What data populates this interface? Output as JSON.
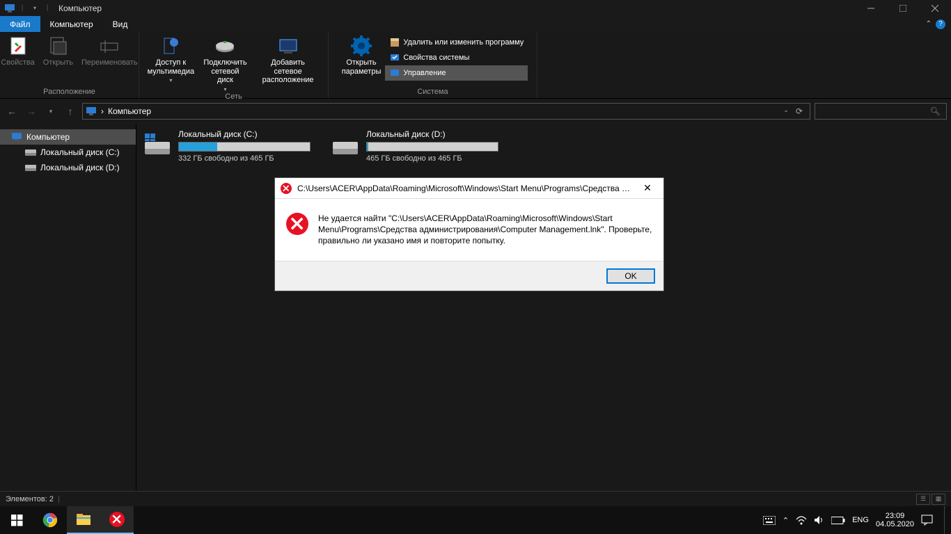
{
  "window": {
    "title": "Компьютер"
  },
  "tabs": {
    "file": "Файл",
    "computer": "Компьютер",
    "view": "Вид"
  },
  "ribbon": {
    "group_location": "Расположение",
    "group_network": "Сеть",
    "group_system": "Система",
    "properties": "Свойства",
    "open": "Открыть",
    "rename": "Переименовать",
    "media": "Доступ к\nмультимедиа",
    "map_drive": "Подключить\nсетевой диск",
    "add_loc": "Добавить сетевое\nрасположение",
    "open_params": "Открыть\nпараметры",
    "uninstall": "Удалить или изменить программу",
    "sys_props": "Свойства системы",
    "manage": "Управление"
  },
  "breadcrumb": {
    "root": "Компьютер"
  },
  "tree": {
    "computer": "Компьютер",
    "disk_c": "Локальный диск (C:)",
    "disk_d": "Локальный диск (D:)"
  },
  "drives": [
    {
      "name": "Локальный диск (C:)",
      "info": "332 ГБ свободно из 465 ГБ",
      "fill": 29
    },
    {
      "name": "Локальный диск (D:)",
      "info": "465 ГБ свободно из 465 ГБ",
      "fill": 1
    }
  ],
  "dialog": {
    "title": "C:\\Users\\ACER\\AppData\\Roaming\\Microsoft\\Windows\\Start Menu\\Programs\\Средства ад...",
    "message": "Не удается найти \"C:\\Users\\ACER\\AppData\\Roaming\\Microsoft\\Windows\\Start Menu\\Programs\\Средства администрирования\\Computer Management.lnk\". Проверьте, правильно ли указано имя и повторите попытку.",
    "ok": "OK"
  },
  "status": {
    "items": "Элементов: 2"
  },
  "tray": {
    "lang": "ENG",
    "time": "23:09",
    "date": "04.05.2020"
  }
}
